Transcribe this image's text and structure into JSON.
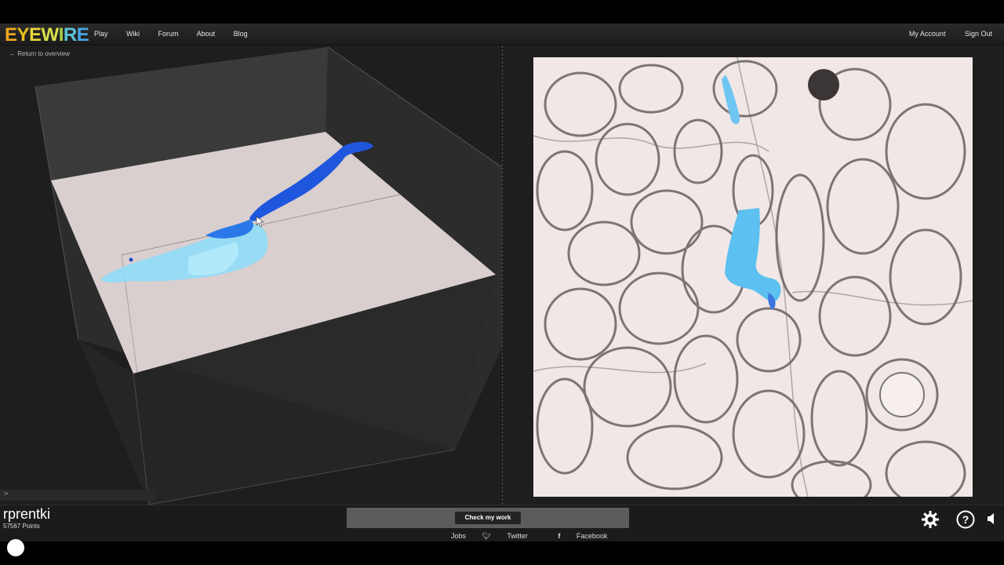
{
  "nav": {
    "logo": [
      "E",
      "Y",
      "E",
      "W",
      "I",
      "R",
      "E"
    ],
    "links": [
      "Play",
      "Wiki",
      "Forum",
      "About",
      "Blog"
    ],
    "right": [
      "My Account",
      "Sign Out"
    ]
  },
  "left": {
    "back_link": "← Return to overview",
    "console_prompt": ">"
  },
  "user": {
    "name": "rprentki",
    "points": "57567 Points"
  },
  "actions": {
    "check_label": "Check my work"
  },
  "footer": {
    "jobs": "Jobs",
    "twitter": "Twitter",
    "facebook": "Facebook"
  },
  "icons": {
    "settings": "gear-icon",
    "help": "help-icon",
    "sound": "speaker-icon"
  },
  "colors": {
    "segment_dark": "#1f5be0",
    "segment_light": "#7fd4f7",
    "segment_cyan": "#59c2f0"
  }
}
